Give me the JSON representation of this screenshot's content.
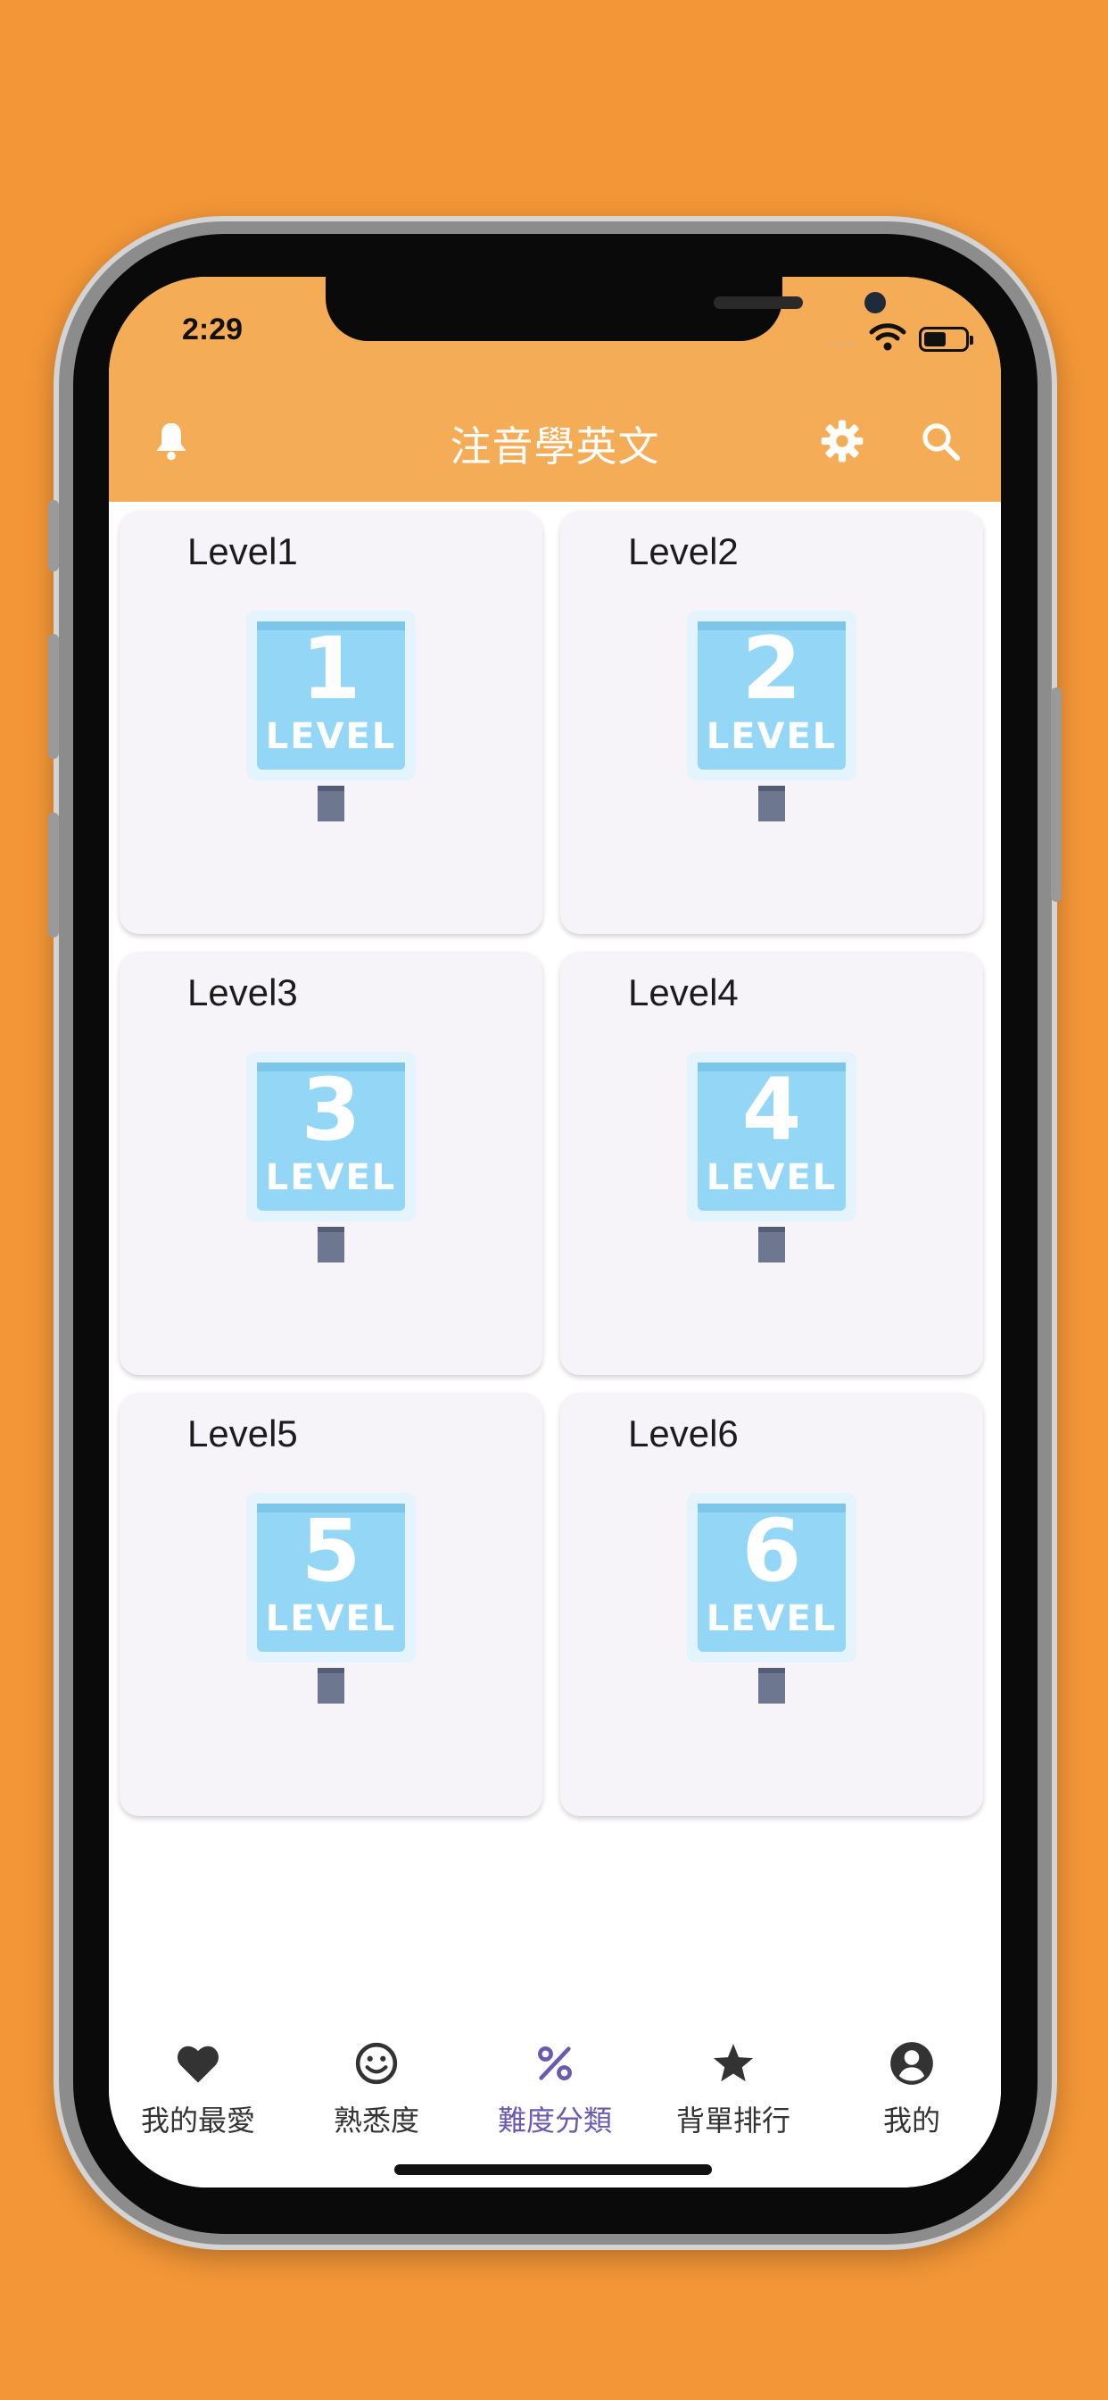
{
  "status": {
    "time": "2:29",
    "signal": "....",
    "icons": [
      "wifi-icon",
      "battery-icon"
    ]
  },
  "appbar": {
    "title": "注音學英文",
    "left_icon": "bell-icon",
    "right_icons": [
      "gear-icon",
      "search-icon"
    ]
  },
  "levels": [
    {
      "label": "Level1",
      "number": "1",
      "word": "LEVEL"
    },
    {
      "label": "Level2",
      "number": "2",
      "word": "LEVEL"
    },
    {
      "label": "Level3",
      "number": "3",
      "word": "LEVEL"
    },
    {
      "label": "Level4",
      "number": "4",
      "word": "LEVEL"
    },
    {
      "label": "Level5",
      "number": "5",
      "word": "LEVEL"
    },
    {
      "label": "Level6",
      "number": "6",
      "word": "LEVEL"
    }
  ],
  "bottom_nav": {
    "items": [
      {
        "label": "我的最愛",
        "icon": "heart-icon"
      },
      {
        "label": "熟悉度",
        "icon": "smiley-icon"
      },
      {
        "label": "難度分類",
        "icon": "percent-icon",
        "active": true
      },
      {
        "label": "背單排行",
        "icon": "star-icon"
      },
      {
        "label": "我的",
        "icon": "account-icon"
      }
    ]
  },
  "colors": {
    "background": "#F39637",
    "header": "#F4AC56",
    "card": "#F6F3F9",
    "active_nav": "#6B5BB0",
    "sign_blue": "#94D6F5"
  }
}
